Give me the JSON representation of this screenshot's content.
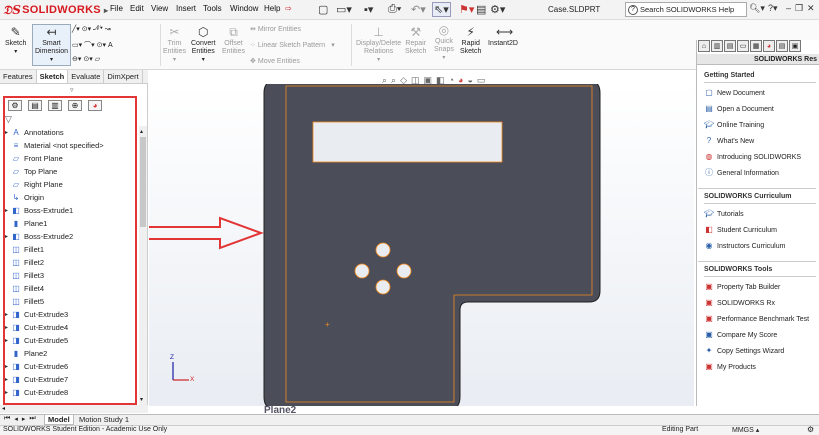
{
  "app": {
    "logo": "SOLIDWORKS",
    "doc_title": "Case.SLDPRT"
  },
  "menu": [
    "File",
    "Edit",
    "View",
    "Insert",
    "Tools",
    "Window",
    "Help"
  ],
  "search": {
    "placeholder": "Search SOLIDWORKS Help"
  },
  "ribbon": {
    "sketch": "Sketch",
    "smart_dimension": [
      "Smart",
      "Dimension"
    ],
    "trim": [
      "Trim",
      "Entities"
    ],
    "convert": [
      "Convert",
      "Entities"
    ],
    "offset": [
      "Offset",
      "Entities"
    ],
    "mirror": "Mirror Entities",
    "linear_pattern": "Linear Sketch Pattern",
    "move": "Move Entities",
    "display_delete": [
      "Display/Delete",
      "Relations"
    ],
    "repair": [
      "Repair",
      "Sketch"
    ],
    "quick_snaps": [
      "Quick",
      "Snaps"
    ],
    "rapid_sketch": [
      "Rapid",
      "Sketch"
    ],
    "instant2d": "Instant2D"
  },
  "cm_tabs": [
    "Features",
    "Sketch",
    "Evaluate",
    "DimXpert"
  ],
  "tree": [
    {
      "label": "Annotations",
      "icon": "A"
    },
    {
      "label": "Material <not specified>",
      "icon": "≡"
    },
    {
      "label": "Front Plane",
      "icon": "▱"
    },
    {
      "label": "Top Plane",
      "icon": "▱"
    },
    {
      "label": "Right Plane",
      "icon": "▱"
    },
    {
      "label": "Origin",
      "icon": "↳"
    },
    {
      "label": "Boss-Extrude1",
      "icon": "◧"
    },
    {
      "label": "Plane1",
      "icon": "▮"
    },
    {
      "label": "Boss-Extrude2",
      "icon": "◧"
    },
    {
      "label": "Fillet1",
      "icon": "◫"
    },
    {
      "label": "Fillet2",
      "icon": "◫"
    },
    {
      "label": "Fillet3",
      "icon": "◫"
    },
    {
      "label": "Fillet4",
      "icon": "◫"
    },
    {
      "label": "Fillet5",
      "icon": "◫"
    },
    {
      "label": "Cut-Extrude3",
      "icon": "◨"
    },
    {
      "label": "Cut-Extrude4",
      "icon": "◨"
    },
    {
      "label": "Cut-Extrude5",
      "icon": "◨"
    },
    {
      "label": "Plane2",
      "icon": "▮"
    },
    {
      "label": "Cut-Extrude6",
      "icon": "◨"
    },
    {
      "label": "Cut-Extrude7",
      "icon": "◨"
    },
    {
      "label": "Cut-Extrude8",
      "icon": "◨"
    }
  ],
  "canvas": {
    "plane_label": "Plane2",
    "axis_z": "Z",
    "axis_x": "X"
  },
  "task_pane": {
    "header": "SOLIDWORKS Res",
    "sections": [
      {
        "title": "Getting Started",
        "items": [
          "New Document",
          "Open a Document",
          "Online Training",
          "What's New",
          "Introducing SOLIDWORKS",
          "General Information"
        ]
      },
      {
        "title": "SOLIDWORKS Curriculum",
        "items": [
          "Tutorials",
          "Student Curriculum",
          "Instructors Curriculum"
        ]
      },
      {
        "title": "SOLIDWORKS Tools",
        "items": [
          "Property Tab Builder",
          "SOLIDWORKS Rx",
          "Performance Benchmark Test",
          "Compare My Score",
          "Copy Settings Wizard",
          "My Products"
        ]
      }
    ]
  },
  "bottom_tabs": [
    "Model",
    "Motion Study 1"
  ],
  "status": {
    "left": "SOLIDWORKS Student Edition - Academic Use Only",
    "mode": "Editing Part",
    "units": "MMGS"
  },
  "colors": {
    "accent_red": "#e23535",
    "part_face": "#4b4d59",
    "edge_orange": "#f28a1e",
    "brand_red": "#d71920"
  }
}
